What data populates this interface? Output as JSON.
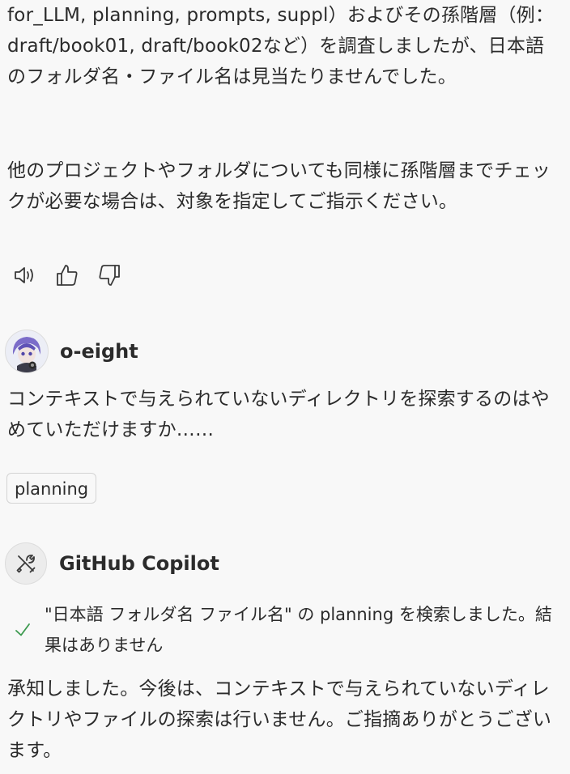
{
  "assistant_prev": {
    "paragraph1": "for_LLM, planning, prompts, suppl）およびその孫階層（例：draft/book01, draft/book02など）を調査しましたが、日本語のフォルダ名・ファイル名は見当たりませんでした。",
    "paragraph2": "他のプロジェクトやフォルダについても同様に孫階層までチェックが必要な場合は、対象を指定してご指示ください。",
    "actions": [
      "speaker-icon",
      "thumbs-up-icon",
      "thumbs-down-icon"
    ]
  },
  "user": {
    "name": "o-eight",
    "message": "コンテキストで与えられていないディレクトリを探索するのはやめていただけますか……",
    "context_chip": "planning"
  },
  "copilot": {
    "name": "GitHub Copilot",
    "search_status": "\"日本語 フォルダ名 ファイル名\" の planning を検索しました。結果はありません",
    "reply": "承知しました。今後は、コンテキストで与えられていないディレクトリやファイルの探索は行いません。ご指摘ありがとうございます。",
    "colors": {
      "check": "#3c9a4f"
    }
  }
}
